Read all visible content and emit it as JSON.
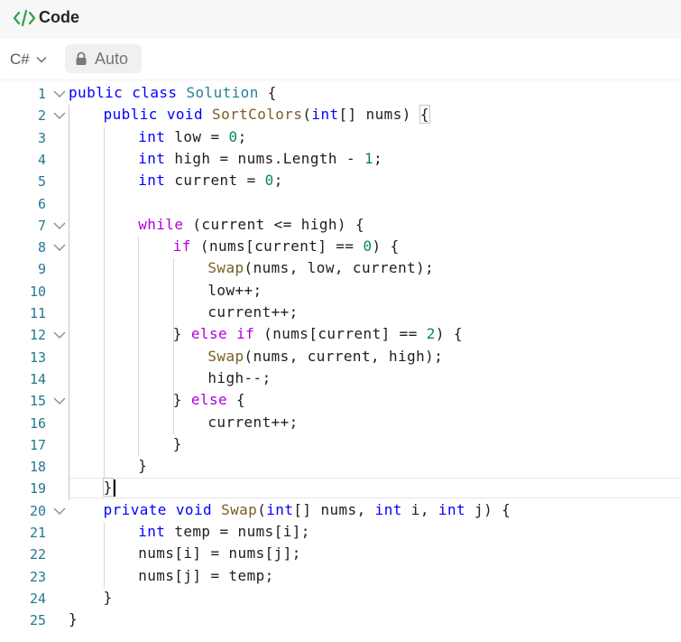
{
  "header": {
    "title": "Code"
  },
  "toolbar": {
    "language": "C#",
    "mode": "Auto"
  },
  "editor": {
    "active_line": 19,
    "lines": [
      {
        "n": "1",
        "fold": true,
        "indent": 0,
        "tokens": [
          [
            "kw",
            "public"
          ],
          [
            "t",
            " "
          ],
          [
            "kw",
            "class"
          ],
          [
            "t",
            " "
          ],
          [
            "cls",
            "Solution"
          ],
          [
            "t",
            " {"
          ]
        ]
      },
      {
        "n": "2",
        "fold": true,
        "indent": 1,
        "tokens": [
          [
            "kw",
            "public"
          ],
          [
            "t",
            " "
          ],
          [
            "kw",
            "void"
          ],
          [
            "t",
            " "
          ],
          [
            "fn",
            "SortColors"
          ],
          [
            "t",
            "("
          ],
          [
            "kw",
            "int"
          ],
          [
            "t",
            "[] nums) "
          ],
          [
            "br",
            "{"
          ]
        ]
      },
      {
        "n": "3",
        "fold": false,
        "indent": 2,
        "tokens": [
          [
            "kw",
            "int"
          ],
          [
            "t",
            " low = "
          ],
          [
            "num",
            "0"
          ],
          [
            "t",
            ";"
          ]
        ]
      },
      {
        "n": "4",
        "fold": false,
        "indent": 2,
        "tokens": [
          [
            "kw",
            "int"
          ],
          [
            "t",
            " high = nums.Length - "
          ],
          [
            "num",
            "1"
          ],
          [
            "t",
            ";"
          ]
        ]
      },
      {
        "n": "5",
        "fold": false,
        "indent": 2,
        "tokens": [
          [
            "kw",
            "int"
          ],
          [
            "t",
            " current = "
          ],
          [
            "num",
            "0"
          ],
          [
            "t",
            ";"
          ]
        ]
      },
      {
        "n": "6",
        "fold": false,
        "indent": 0,
        "tokens": []
      },
      {
        "n": "7",
        "fold": true,
        "indent": 2,
        "tokens": [
          [
            "cf",
            "while"
          ],
          [
            "t",
            " (current <= high) {"
          ]
        ]
      },
      {
        "n": "8",
        "fold": true,
        "indent": 3,
        "tokens": [
          [
            "cf",
            "if"
          ],
          [
            "t",
            " (nums[current] == "
          ],
          [
            "num",
            "0"
          ],
          [
            "t",
            ") {"
          ]
        ]
      },
      {
        "n": "9",
        "fold": false,
        "indent": 4,
        "tokens": [
          [
            "fn",
            "Swap"
          ],
          [
            "t",
            "(nums, low, current);"
          ]
        ]
      },
      {
        "n": "10",
        "fold": false,
        "indent": 4,
        "tokens": [
          [
            "t",
            "low++;"
          ]
        ]
      },
      {
        "n": "11",
        "fold": false,
        "indent": 4,
        "tokens": [
          [
            "t",
            "current++;"
          ]
        ]
      },
      {
        "n": "12",
        "fold": true,
        "indent": 3,
        "tokens": [
          [
            "t",
            "} "
          ],
          [
            "cf",
            "else"
          ],
          [
            "t",
            " "
          ],
          [
            "cf",
            "if"
          ],
          [
            "t",
            " (nums[current] == "
          ],
          [
            "num",
            "2"
          ],
          [
            "t",
            ") {"
          ]
        ]
      },
      {
        "n": "13",
        "fold": false,
        "indent": 4,
        "tokens": [
          [
            "fn",
            "Swap"
          ],
          [
            "t",
            "(nums, current, high);"
          ]
        ]
      },
      {
        "n": "14",
        "fold": false,
        "indent": 4,
        "tokens": [
          [
            "t",
            "high--;"
          ]
        ]
      },
      {
        "n": "15",
        "fold": true,
        "indent": 3,
        "tokens": [
          [
            "t",
            "} "
          ],
          [
            "cf",
            "else"
          ],
          [
            "t",
            " {"
          ]
        ]
      },
      {
        "n": "16",
        "fold": false,
        "indent": 4,
        "tokens": [
          [
            "t",
            "current++;"
          ]
        ]
      },
      {
        "n": "17",
        "fold": false,
        "indent": 3,
        "tokens": [
          [
            "t",
            "}"
          ]
        ]
      },
      {
        "n": "18",
        "fold": false,
        "indent": 2,
        "tokens": [
          [
            "t",
            "}"
          ]
        ]
      },
      {
        "n": "19",
        "fold": false,
        "indent": 1,
        "tokens": [
          [
            "br",
            "}"
          ]
        ]
      },
      {
        "n": "20",
        "fold": true,
        "indent": 1,
        "tokens": [
          [
            "kw",
            "private"
          ],
          [
            "t",
            " "
          ],
          [
            "kw",
            "void"
          ],
          [
            "t",
            " "
          ],
          [
            "fn",
            "Swap"
          ],
          [
            "t",
            "("
          ],
          [
            "kw",
            "int"
          ],
          [
            "t",
            "[] nums, "
          ],
          [
            "kw",
            "int"
          ],
          [
            "t",
            " i, "
          ],
          [
            "kw",
            "int"
          ],
          [
            "t",
            " j) {"
          ]
        ]
      },
      {
        "n": "21",
        "fold": false,
        "indent": 2,
        "tokens": [
          [
            "kw",
            "int"
          ],
          [
            "t",
            " temp = nums[i];"
          ]
        ]
      },
      {
        "n": "22",
        "fold": false,
        "indent": 2,
        "tokens": [
          [
            "t",
            "nums[i] = nums[j];"
          ]
        ]
      },
      {
        "n": "23",
        "fold": false,
        "indent": 2,
        "tokens": [
          [
            "t",
            "nums[j] = temp;"
          ]
        ]
      },
      {
        "n": "24",
        "fold": false,
        "indent": 1,
        "tokens": [
          [
            "t",
            "}"
          ]
        ]
      },
      {
        "n": "25",
        "fold": false,
        "indent": 0,
        "tokens": [
          [
            "t",
            "}"
          ]
        ]
      }
    ]
  },
  "colors": {
    "keyword": "#0000ff",
    "control": "#af00db",
    "type": "#267f99",
    "function": "#795e26",
    "number": "#098658",
    "line_number": "#237893",
    "title_icon": "#2ca44a"
  },
  "icons": {
    "title": "code-icon",
    "lang": "chevron-down-icon",
    "mode": "lock-icon",
    "fold": "chevron-down-icon"
  }
}
